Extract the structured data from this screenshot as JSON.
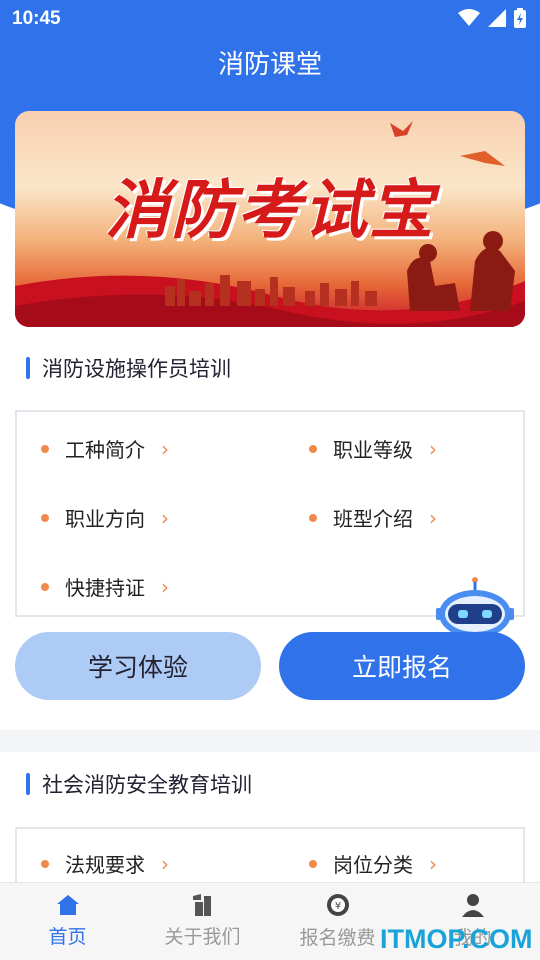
{
  "status": {
    "time": "10:45"
  },
  "header": {
    "title": "消防课堂"
  },
  "banner": {
    "text": "消防考试宝"
  },
  "section1": {
    "title": "消防设施操作员培训",
    "items": [
      "工种简介",
      "职业等级",
      "职业方向",
      "班型介绍",
      "快捷持证"
    ]
  },
  "buttons": {
    "trial": "学习体验",
    "signup": "立即报名"
  },
  "section2": {
    "title": "社会消防安全教育培训",
    "items": [
      "法规要求",
      "岗位分类"
    ]
  },
  "tabs": [
    "首页",
    "关于我们",
    "报名缴费",
    "我的"
  ],
  "watermark": "ITMOP.COM",
  "colors": {
    "primary": "#2f72ea",
    "accent": "#f08a4b"
  }
}
